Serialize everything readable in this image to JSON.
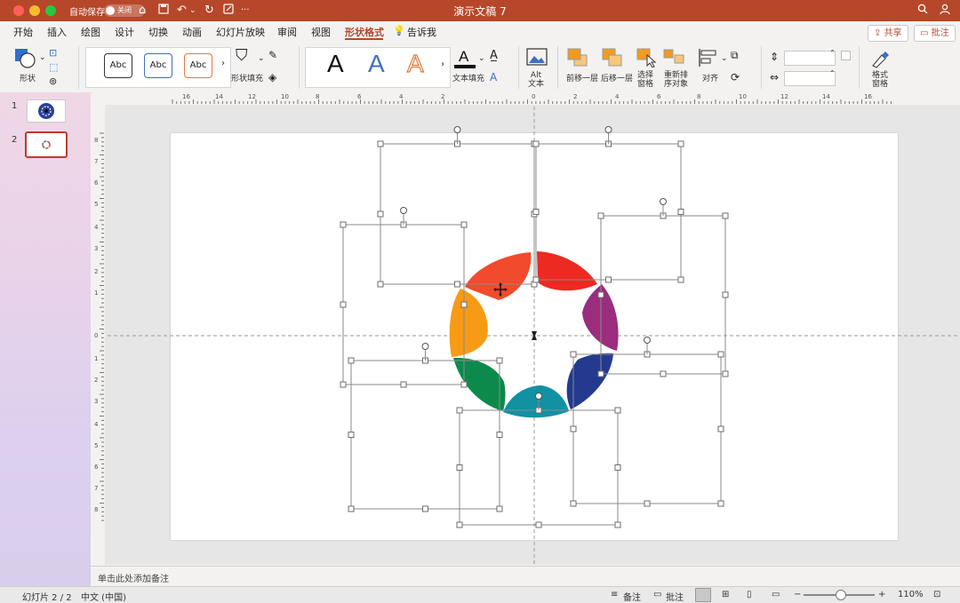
{
  "titlebar": {
    "autosave_label": "自动保存",
    "toggle_label": "关闭",
    "document_title": "演示文稿 7",
    "colors": {
      "bar": "#b7472a",
      "close": "#ff5f57",
      "minimize": "#febc2e",
      "zoom": "#28c840"
    }
  },
  "tabs": [
    "开始",
    "插入",
    "绘图",
    "设计",
    "切换",
    "动画",
    "幻灯片放映",
    "审阅",
    "视图",
    "形状格式",
    "告诉我"
  ],
  "active_tab": "形状格式",
  "topright": {
    "share_label": "共享",
    "comment_label": "批注"
  },
  "ribbon": {
    "shape_label": "形状",
    "style_presets": [
      "Abc",
      "Abc",
      "Abc"
    ],
    "shape_fill_label": "形状填充",
    "wordart": [
      "A",
      "A",
      "A"
    ],
    "text_fill_label": "文本填充",
    "alt_text_label": "Alt\n文本",
    "bring_forward_label": "前移一层",
    "send_backward_label": "后移一层",
    "selection_pane_label": "选择\n窗格",
    "reorder_label": "重新排\n序对象",
    "align_label": "对齐",
    "format_pane_label": "格式\n窗格"
  },
  "rulers": {
    "horizontal_ticks": [
      "16",
      "14",
      "12",
      "10",
      "8",
      "6",
      "4",
      "2",
      "0",
      "2",
      "4",
      "6",
      "8",
      "10",
      "12",
      "14",
      "16"
    ],
    "vertical_ticks": [
      "8",
      "7",
      "6",
      "5",
      "4",
      "3",
      "2",
      "1",
      "0",
      "1",
      "2",
      "3",
      "4",
      "5",
      "6",
      "7",
      "8"
    ]
  },
  "slides": {
    "numbers": [
      "1",
      "2"
    ],
    "current": 2
  },
  "diagram": {
    "petals": [
      {
        "name": "petal-red-orange",
        "color": "#f24a2c"
      },
      {
        "name": "petal-red",
        "color": "#ec2a22"
      },
      {
        "name": "petal-purple",
        "color": "#9a2d7e"
      },
      {
        "name": "petal-navy",
        "color": "#243a8f"
      },
      {
        "name": "petal-teal",
        "color": "#1291a3"
      },
      {
        "name": "petal-green",
        "color": "#0c8a4c"
      },
      {
        "name": "petal-orange",
        "color": "#f79a16"
      }
    ]
  },
  "notes_placeholder": "单击此处添加备注",
  "status": {
    "slide_counter": "幻灯片 2 / 2",
    "language": "中文 (中国)",
    "notes_label": "备注",
    "comments_label": "批注",
    "zoom_minus": "−",
    "zoom_plus": "+",
    "zoom_level": "110%"
  }
}
